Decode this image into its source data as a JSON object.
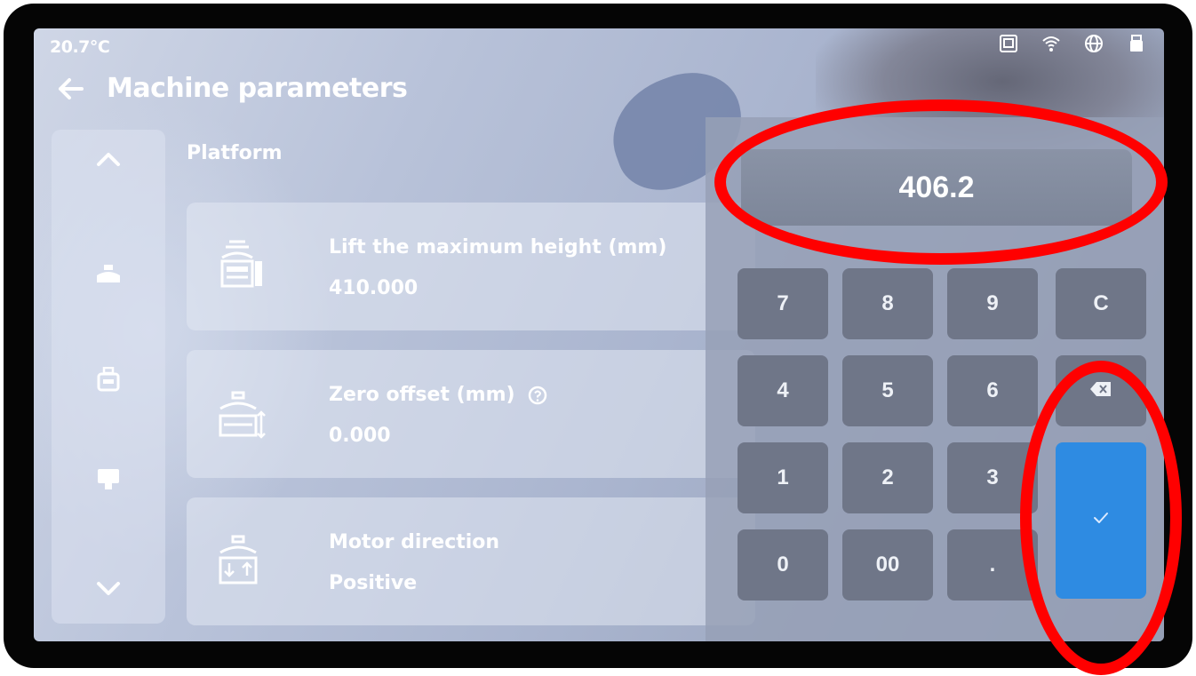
{
  "status_bar": {
    "temperature": "20.7°C",
    "icons": [
      "storage-icon",
      "wifi-icon",
      "globe-icon",
      "usb-icon"
    ]
  },
  "header": {
    "title": "Machine parameters"
  },
  "sidebar": {
    "items": [
      "chevron-up-icon",
      "platform-icon",
      "resin-tank-icon",
      "printer-head-icon",
      "chevron-down-icon"
    ]
  },
  "section": {
    "label": "Platform"
  },
  "parameters": [
    {
      "label": "Lift the maximum height (mm)",
      "value": "410.000",
      "icon": "lift-height-icon"
    },
    {
      "label": "Zero offset (mm)",
      "value": "0.000",
      "icon": "zero-offset-icon"
    },
    {
      "label": "Motor direction",
      "value": "Positive",
      "icon": "motor-direction-icon"
    }
  ],
  "keypad": {
    "display_value": "406.2",
    "keys": [
      "7",
      "8",
      "9",
      "C",
      "4",
      "5",
      "6",
      "⌫",
      "1",
      "2",
      "3",
      "0",
      "00",
      "."
    ],
    "enter_icon": "check-icon"
  },
  "colors": {
    "accent": "#2e8be2",
    "annotation": "#ff0000",
    "key": "#6f7688"
  }
}
